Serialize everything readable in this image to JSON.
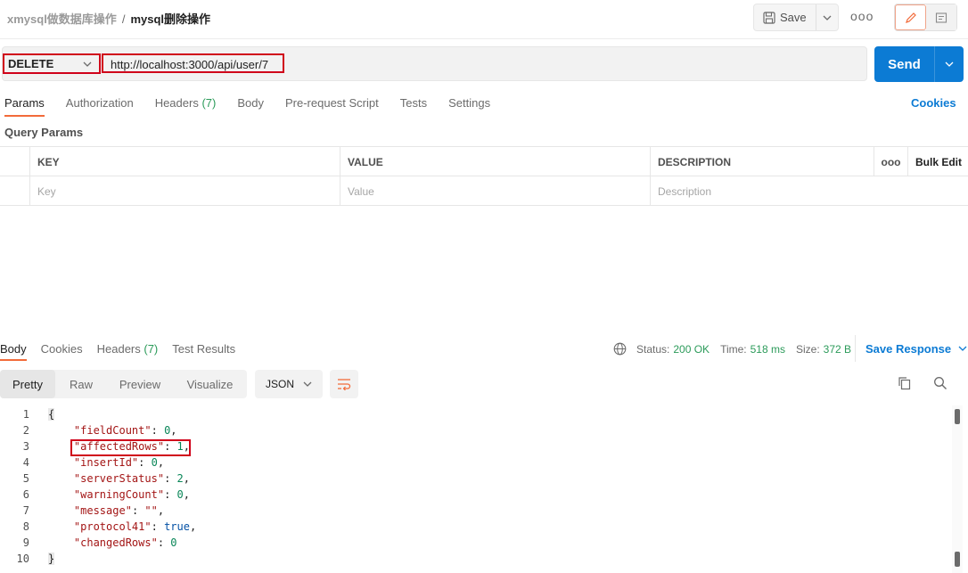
{
  "header": {
    "collection": "xmysql做数据库操作",
    "separator": "/",
    "request_name": "mysql删除操作",
    "save_label": "Save",
    "more_icon": "ooo"
  },
  "request": {
    "method": "DELETE",
    "url": "http://localhost:3000/api/user/7",
    "send_label": "Send"
  },
  "request_tabs": {
    "params": "Params",
    "authorization": "Authorization",
    "headers": "Headers",
    "headers_count": "(7)",
    "body": "Body",
    "pre_request": "Pre-request Script",
    "tests": "Tests",
    "settings": "Settings",
    "cookies": "Cookies"
  },
  "query_params": {
    "title": "Query Params",
    "columns": {
      "key": "KEY",
      "value": "VALUE",
      "description": "DESCRIPTION"
    },
    "more": "ooo",
    "bulk_edit": "Bulk Edit",
    "placeholders": {
      "key": "Key",
      "value": "Value",
      "description": "Description"
    }
  },
  "response_tabs": {
    "body": "Body",
    "cookies": "Cookies",
    "headers": "Headers",
    "headers_count": "(7)",
    "test_results": "Test Results"
  },
  "response_meta": {
    "status_label": "Status:",
    "status_value": "200 OK",
    "time_label": "Time:",
    "time_value": "518 ms",
    "size_label": "Size:",
    "size_value": "372 B",
    "save_response": "Save Response"
  },
  "view_options": {
    "pretty": "Pretty",
    "raw": "Raw",
    "preview": "Preview",
    "visualize": "Visualize",
    "format": "JSON"
  },
  "code": {
    "line_numbers": [
      "1",
      "2",
      "3",
      "4",
      "5",
      "6",
      "7",
      "8",
      "9",
      "10"
    ],
    "open_brace": "{",
    "close_brace": "}",
    "fields": [
      {
        "key": "\"fieldCount\"",
        "value": "0",
        "type": "number",
        "comma": ","
      },
      {
        "key": "\"affectedRows\"",
        "value": "1",
        "type": "number",
        "comma": ","
      },
      {
        "key": "\"insertId\"",
        "value": "0",
        "type": "number",
        "comma": ","
      },
      {
        "key": "\"serverStatus\"",
        "value": "2",
        "type": "number",
        "comma": ","
      },
      {
        "key": "\"warningCount\"",
        "value": "0",
        "type": "number",
        "comma": ","
      },
      {
        "key": "\"message\"",
        "value": "\"\"",
        "type": "string",
        "comma": ","
      },
      {
        "key": "\"protocol41\"",
        "value": "true",
        "type": "bool",
        "comma": ","
      },
      {
        "key": "\"changedRows\"",
        "value": "0",
        "type": "number",
        "comma": ""
      }
    ]
  },
  "colors": {
    "accent_blue": "#0c7bd4",
    "tab_underline": "#f26b3a",
    "highlight_red": "#d0021b",
    "status_green": "#2c9b5a"
  }
}
